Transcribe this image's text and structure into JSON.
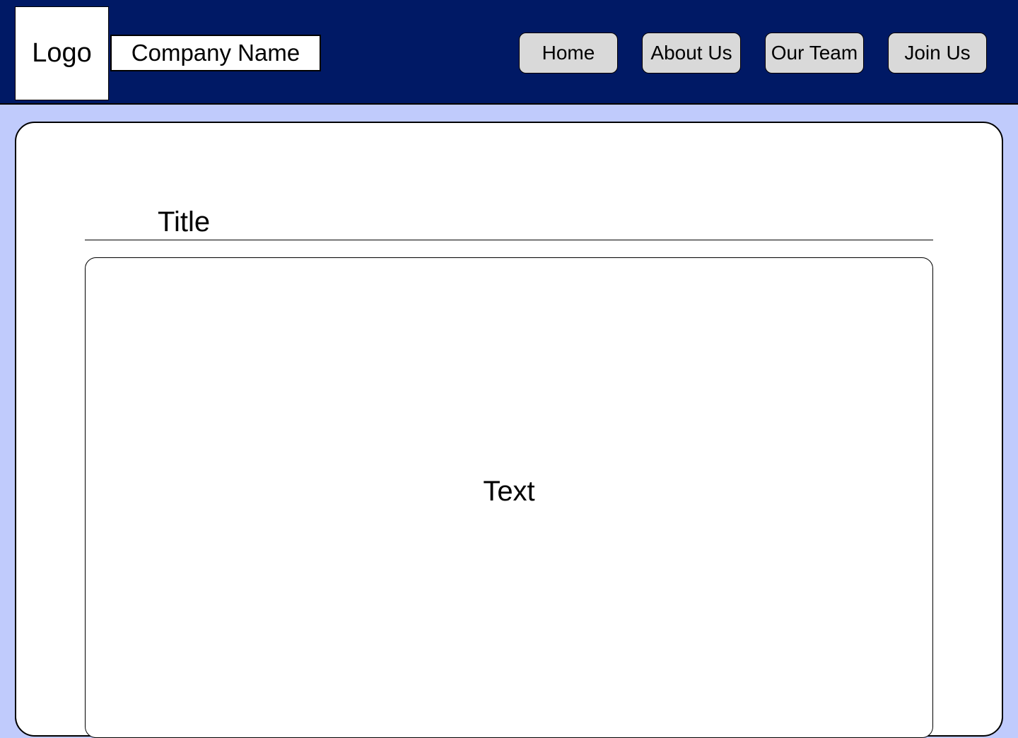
{
  "header": {
    "logo_label": "Logo",
    "company_name": "Company Name",
    "background_color": "#001965"
  },
  "nav": {
    "items": [
      {
        "label": "Home"
      },
      {
        "label": "About Us"
      },
      {
        "label": "Our Team"
      },
      {
        "label": "Join Us"
      }
    ],
    "button_color": "#d9d9d9"
  },
  "main": {
    "title": "Title",
    "content_text": "Text"
  },
  "colors": {
    "page_background": "#c0cbfc",
    "card_background": "#ffffff"
  }
}
